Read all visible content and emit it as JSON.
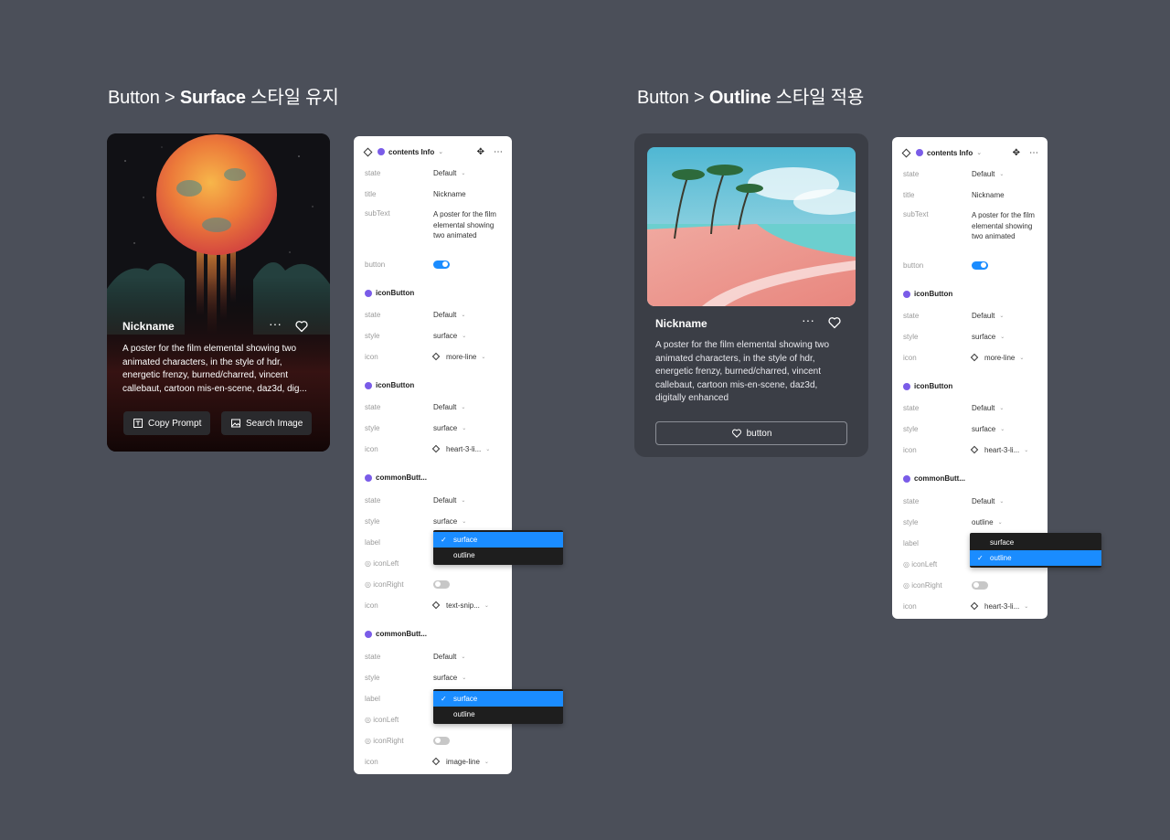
{
  "left_heading": {
    "prefix": "Button > ",
    "bold": "Surface",
    "suffix": " 스타일 유지"
  },
  "right_heading": {
    "prefix": "Button > ",
    "bold": "Outline",
    "suffix": " 스타일 적용"
  },
  "card_surface": {
    "nickname": "Nickname",
    "more": "···",
    "description": "A poster for the film elemental showing two animated characters, in the style of hdr, energetic frenzy, burned/charred, vincent callebaut, cartoon mis-en-scene, daz3d, dig...",
    "button1": "Copy Prompt",
    "button2": "Search Image"
  },
  "card_outline": {
    "nickname": "Nickname",
    "more": "···",
    "description": "A poster for the film elemental showing two animated characters, in the style of hdr, energetic frenzy, burned/charred, vincent callebaut, cartoon mis-en-scene, daz3d, digitally enhanced",
    "button": "button"
  },
  "panel_common": {
    "title": "contents Info",
    "state_label": "state",
    "state_value": "Default",
    "title_label": "title",
    "title_value": "Nickname",
    "subtext_label": "subText",
    "subtext_value": "A poster for the film elemental showing two animated",
    "button_label": "button",
    "icon_button": "iconButton",
    "common_button": "commonButt...",
    "style_label": "style",
    "style_value": "surface",
    "icon_label": "icon",
    "label_label": "label",
    "icon_left": "iconLeft",
    "icon_right": "iconRight"
  },
  "panel_left": {
    "icon1": "more-line",
    "icon2": "heart-3-li...",
    "icon3": "text-snip...",
    "icon4": "image-line",
    "dropdown1": [
      "surface",
      "outline"
    ],
    "dropdown2": [
      "surface",
      "outline"
    ]
  },
  "panel_right": {
    "icon1": "more-line",
    "icon2": "heart-3-li...",
    "common_style": "outline",
    "icon3": "heart-3-li...",
    "dropdown": [
      "surface",
      "outline"
    ]
  },
  "colors": {
    "background": "#4b4f59",
    "accent": "#1a8cff",
    "dot": "#7a5ce8"
  }
}
